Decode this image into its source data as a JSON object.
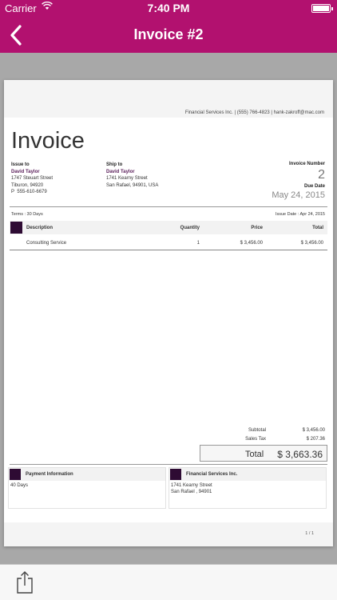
{
  "status_bar": {
    "carrier": "Carrier",
    "time": "7:40 PM"
  },
  "nav": {
    "title": "Invoice #2"
  },
  "colors": {
    "brand": "#b2116f",
    "accent_swatch": "#2e0b33",
    "customer_name": "#5a1e5a"
  },
  "invoice": {
    "company_contact": "Financial Services Inc. | (555) 766-4823 | hank-zakroff@mac.com",
    "title": "Invoice",
    "issue_to": {
      "label": "Issue to",
      "name": "David Taylor",
      "line1": "1747 Steuart Street",
      "line2": "Tiburon, 94920",
      "phone_glyph": "P",
      "phone": "555-610-6679"
    },
    "ship_to": {
      "label": "Ship to",
      "name": "David Taylor",
      "line1": "1741 Kearny Street",
      "line2": "San Rafael, 94901, USA"
    },
    "number_label": "Invoice Number",
    "number": "2",
    "due_label": "Due Date",
    "due_date": "May 24, 2015",
    "terms": "Terms : 30 Days",
    "issue_date": "Issue Date : Apr 24, 2015",
    "table": {
      "headers": [
        "Description",
        "Quantity",
        "Price",
        "Total"
      ],
      "rows": [
        {
          "description": "Consulting Service",
          "quantity": "1",
          "price": "$ 3,456.00",
          "total": "$ 3,456.00"
        }
      ]
    },
    "summary": {
      "subtotal_label": "Subtotal",
      "subtotal": "$ 3,456.00",
      "tax_label": "Sales Tax",
      "tax": "$ 207.36",
      "total_label": "Total",
      "total": "$ 3,663.36"
    },
    "payment": {
      "title": "Payment Information",
      "body": "40 Days"
    },
    "company": {
      "title": "Financial Services Inc.",
      "line1": "1741 Kearny Street",
      "line2": "San Rafael , 94901"
    },
    "page": "1 / 1"
  },
  "icons": {
    "back": "chevron-left-icon",
    "share": "share-icon"
  }
}
